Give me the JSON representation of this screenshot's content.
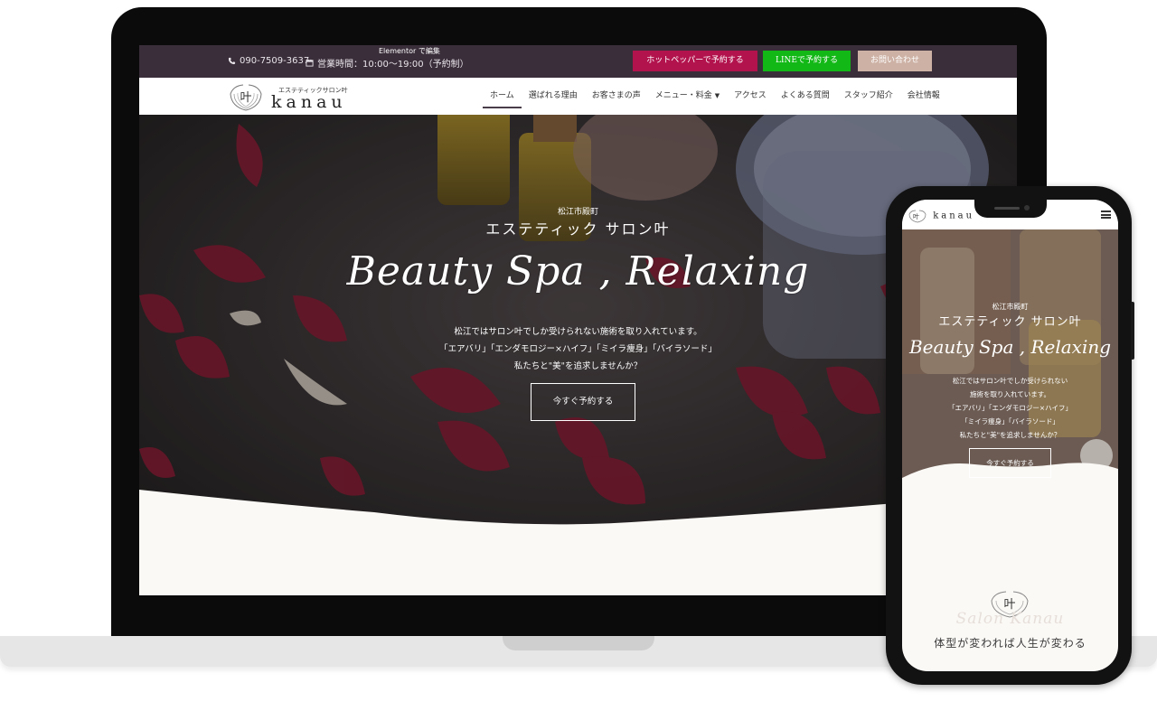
{
  "desktop": {
    "topbar": {
      "editor_label": "Elementor で編集",
      "phone": "090-7509-3637",
      "hours": "営業時間：10:00〜19:00（予約制）",
      "buttons": {
        "hotpepper": "ホットペッパーで予約する",
        "line": "LINEで予約する",
        "contact": "お問い合わせ"
      }
    },
    "logo": {
      "subtitle": "エステティックサロン叶",
      "wordmark": "kanau",
      "emblem_char": "叶"
    },
    "nav": {
      "items": [
        {
          "label": "ホーム",
          "active": true
        },
        {
          "label": "選ばれる理由"
        },
        {
          "label": "お客さまの声"
        },
        {
          "label": "メニュー・料金",
          "has_dropdown": true
        },
        {
          "label": "アクセス"
        },
        {
          "label": "よくある質問"
        },
        {
          "label": "スタッフ紹介"
        },
        {
          "label": "会社情報"
        }
      ]
    },
    "hero": {
      "area": "松江市殿町",
      "salon_name": "エステティック サロン叶",
      "script_title": "Beauty Spa , Relaxing",
      "desc_line1": "松江ではサロン叶でしか受けられない施術を取り入れています。",
      "desc_line2": "「エアバリ」「エンダモロジー×ハイフ」「ミイラ痩身」「バイラソード」",
      "desc_line3": "私たちと\"美\"を追求しませんか？",
      "cta": "今すぐ予約する"
    }
  },
  "mobile": {
    "logo": {
      "subtitle": "エステティックサロン叶",
      "wordmark": "kanau",
      "emblem_char": "叶"
    },
    "hero": {
      "area": "松江市殿町",
      "salon_name": "エステティック サロン叶",
      "script_title": "Beauty Spa , Relaxing",
      "desc_line1": "松江ではサロン叶でしか受けられない",
      "desc_line2": "施術を取り入れています。",
      "desc_line3": "「エアバリ」「エンダモロジー×ハイフ」",
      "desc_line4": "「ミイラ痩身」「バイラソード」",
      "desc_line5": "私たちと\"美\"を追求しませんか？",
      "cta": "今すぐ予約する"
    },
    "section": {
      "emblem_char": "叶",
      "script": "Salon Kanau",
      "tagline": "体型が変われば人生が変わる"
    }
  },
  "colors": {
    "topbar_bg": "#3a2e3a",
    "hotpepper": "#b3134d",
    "line": "#12b816",
    "contact": "#cdb1a4",
    "cream": "#fbf9f6"
  },
  "icons": [
    "phone-icon",
    "calendar-icon",
    "chevron-down-icon",
    "hamburger-menu-icon"
  ]
}
